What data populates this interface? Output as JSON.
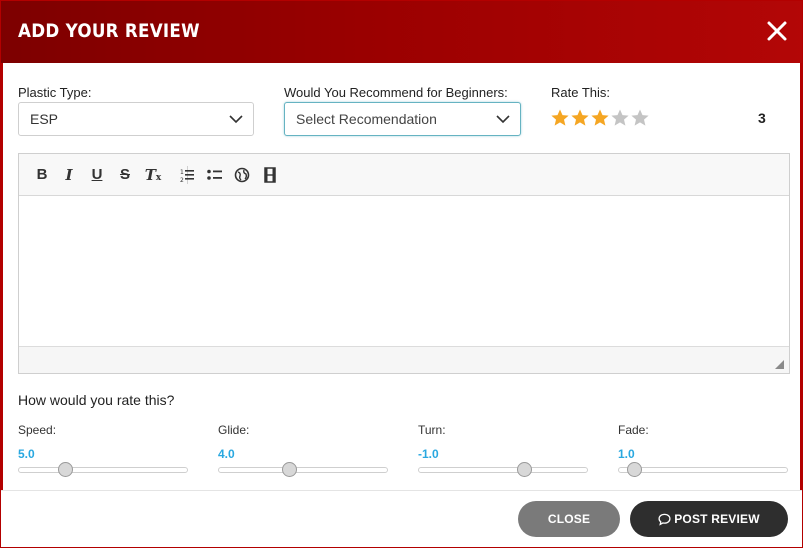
{
  "header": {
    "title": "ADD YOUR REVIEW",
    "close_icon": "close-icon"
  },
  "form": {
    "plastic_type": {
      "label": "Plastic Type:",
      "value": "ESP"
    },
    "recommend": {
      "label": "Would You Recommend for Beginners:",
      "placeholder": "Select Recomendation"
    },
    "rating": {
      "label": "Rate This:",
      "value": "3",
      "max": 5,
      "filled": 3,
      "star_color": "#f5a623",
      "empty_color": "#c4c4c4"
    }
  },
  "editor": {
    "toolbar": [
      "bold-icon",
      "italic-icon",
      "underline-icon",
      "strikethrough-icon",
      "clear-format-icon",
      "numbered-list-icon",
      "bulleted-list-icon",
      "link-globe-icon",
      "media-film-icon"
    ],
    "content": ""
  },
  "flight": {
    "title": "How would you rate this?",
    "sliders": [
      {
        "label": "Speed:",
        "value": "5.0",
        "fraction": 0.26
      },
      {
        "label": "Glide:",
        "value": "4.0",
        "fraction": 0.41
      },
      {
        "label": "Turn:",
        "value": "-1.0",
        "fraction": 0.64
      },
      {
        "label": "Fade:",
        "value": "1.0",
        "fraction": 0.06
      }
    ]
  },
  "footer": {
    "close_label": "CLOSE",
    "post_label": "POST REVIEW"
  },
  "colors": {
    "header_dark": "#7d0000",
    "header_light": "#b30606",
    "slider_value": "#29a8e0",
    "close_button": "#7a7a7a",
    "post_button": "#2e2e2e"
  }
}
